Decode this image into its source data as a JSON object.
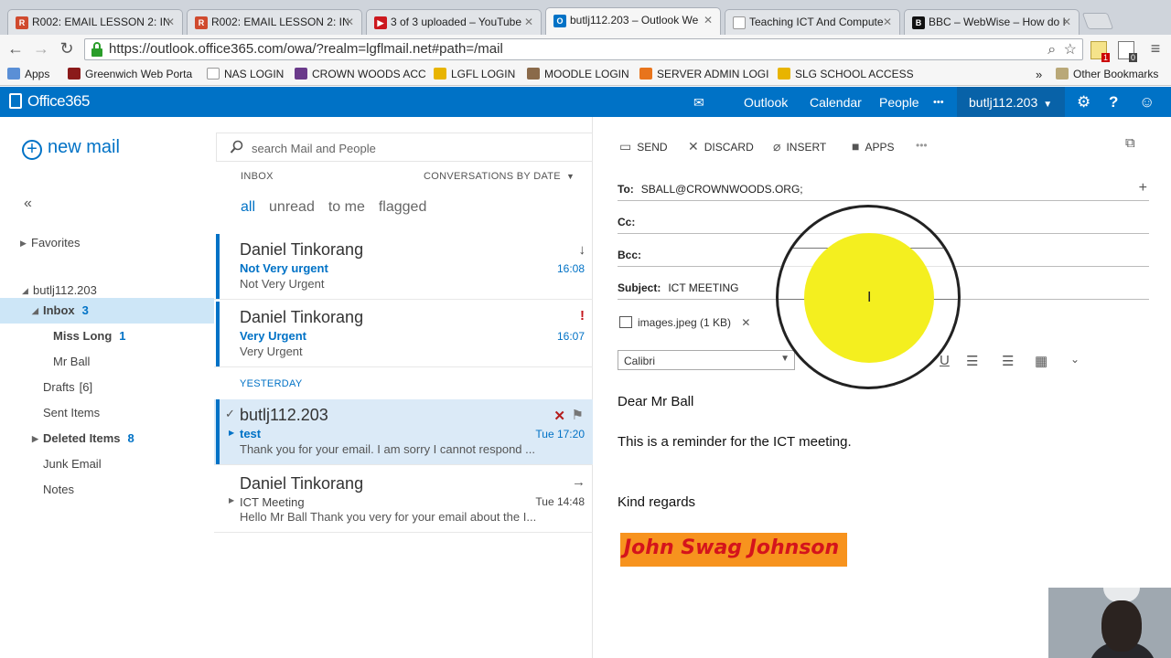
{
  "browser": {
    "tabs": [
      {
        "title": "R002: EMAIL LESSON 2: INT",
        "fav_color": "#d04a2e",
        "fav": "ri-icon"
      },
      {
        "title": "R002: EMAIL LESSON 2: INT",
        "fav_color": "#d04a2e",
        "fav": "ri-icon"
      },
      {
        "title": "3 of 3 uploaded – YouTube",
        "fav_color": "#cc181e",
        "fav": "youtube-icon"
      },
      {
        "title": "butlj112.203 – Outlook We",
        "fav_color": "#0072c6",
        "fav": "outlook-icon"
      },
      {
        "title": "Teaching ICT And Compute",
        "fav_color": "#ffffff",
        "fav": "page-icon"
      },
      {
        "title": "BBC – WebWise – How do I",
        "fav_color": "#111111",
        "fav": "bbc-icon"
      }
    ],
    "url": "https://outlook.office365.com/owa/?realm=lgflmail.net#path=/mail",
    "extension_badges": [
      "1",
      "0"
    ],
    "bookmarks": [
      {
        "label": "Apps",
        "color": "#5a8fd6"
      },
      {
        "label": "Greenwich Web Porta",
        "color": "#8b1a1a"
      },
      {
        "label": "NAS LOGIN",
        "color": "#ffffff"
      },
      {
        "label": "CROWN WOODS ACC",
        "color": "#6a3a8a"
      },
      {
        "label": "LGFL LOGIN",
        "color": "#e8b400"
      },
      {
        "label": "MOODLE LOGIN",
        "color": "#8a6a4a"
      },
      {
        "label": "SERVER ADMIN LOGI",
        "color": "#e8741c"
      },
      {
        "label": "SLG SCHOOL ACCESS",
        "color": "#e8b400"
      }
    ],
    "overflow": "»",
    "other_bookmarks": "Other Bookmarks"
  },
  "header": {
    "brand": "Office365",
    "nav": [
      "Outlook",
      "Calendar",
      "People"
    ],
    "more": "•••",
    "user": "butlj112.203",
    "colors": {
      "brand_bar": "#0072c6",
      "user_bg": "#0862a8"
    }
  },
  "leftnav": {
    "new_mail": "new mail",
    "collapse": "«",
    "favorites": "Favorites",
    "account": "butlj112.203",
    "folders": [
      {
        "label": "Inbox",
        "count": "3",
        "bold": true,
        "selected": true
      },
      {
        "label": "Miss Long",
        "count": "1",
        "bold": true,
        "indent": 2
      },
      {
        "label": "Mr Ball",
        "count": "",
        "indent": 2
      },
      {
        "label": "Drafts",
        "count": "[6]"
      },
      {
        "label": "Sent Items",
        "count": ""
      },
      {
        "label": "Deleted Items",
        "count": "8",
        "bold": true
      },
      {
        "label": "Junk Email",
        "count": ""
      },
      {
        "label": "Notes",
        "count": ""
      }
    ]
  },
  "list": {
    "search_placeholder": "search Mail and People",
    "folder_label": "INBOX",
    "sort_label": "CONVERSATIONS BY DATE",
    "filters": [
      "all",
      "unread",
      "to me",
      "flagged"
    ],
    "yesterday": "YESTERDAY",
    "messages": [
      {
        "from": "Daniel Tinkorang",
        "subject": "Not Very urgent",
        "preview": "Not Very Urgent",
        "time": "16:08",
        "flag": "↓"
      },
      {
        "from": "Daniel Tinkorang",
        "subject": "Very Urgent",
        "preview": "Very Urgent",
        "time": "16:07",
        "flag": "!"
      },
      {
        "from": "butlj112.203",
        "subject": "test",
        "preview": "Thank you for your email.  I am sorry I cannot respond ...",
        "time": "Tue 17:20"
      },
      {
        "from": "Daniel Tinkorang",
        "subject": "ICT Meeting",
        "preview": "Hello Mr Ball  Thank you very for your email about the I...",
        "time": "Tue 14:48",
        "flag": "→"
      }
    ]
  },
  "compose": {
    "actions": [
      "SEND",
      "DISCARD",
      "INSERT",
      "APPS"
    ],
    "more": "•••",
    "to_label": "To:",
    "to_value": "SBALL@CROWNWOODS.ORG;",
    "cc_label": "Cc:",
    "bcc_label": "Bcc:",
    "subject_label": "Subject:",
    "subject_value": "ICT MEETING",
    "attachment": "images.jpeg (1 KB)",
    "font": "Calibri",
    "body": [
      "Dear Mr Ball",
      "This is a reminder for the ICT meeting.",
      "Kind regards"
    ],
    "signature": "John Swag Johnson",
    "colors": {
      "signature_bg": "#f7931e",
      "signature_text": "#d4141c",
      "highlight": "#f4ef1f"
    }
  }
}
